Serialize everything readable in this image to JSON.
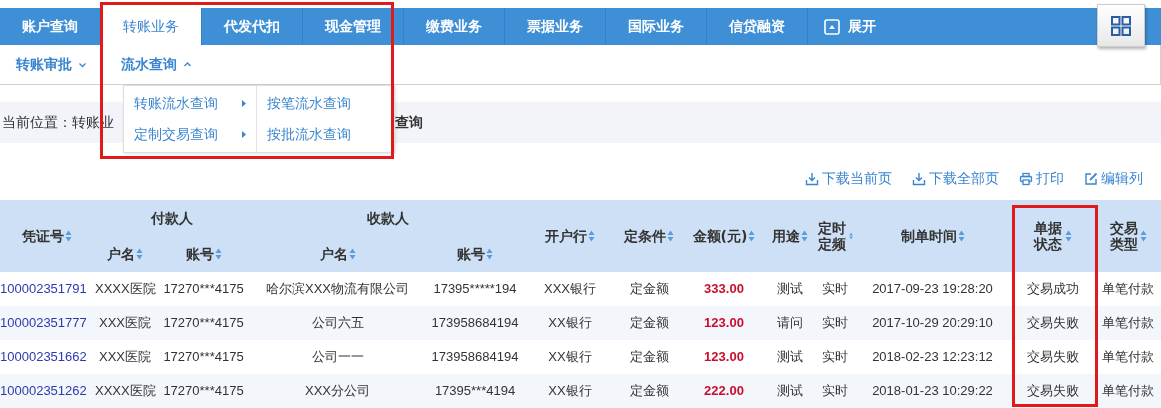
{
  "nav": {
    "tabs": [
      {
        "label": "账户查询",
        "selected": false
      },
      {
        "label": "转账业务",
        "selected": true
      },
      {
        "label": "代发代扣",
        "selected": false
      },
      {
        "label": "现金管理",
        "selected": false
      },
      {
        "label": "缴费业务",
        "selected": false
      },
      {
        "label": "票据业务",
        "selected": false
      },
      {
        "label": "国际业务",
        "selected": false
      },
      {
        "label": "信贷融资",
        "selected": false
      }
    ],
    "expand_button": {
      "label": "展开"
    }
  },
  "subnav": [
    {
      "label": "转账审批",
      "expanded": false
    },
    {
      "label": "流水查询",
      "expanded": true
    }
  ],
  "dropdown": {
    "items": [
      {
        "label": "转账流水查询",
        "has_submenu": true
      },
      {
        "label": "定制交易查询",
        "has_submenu": true
      }
    ],
    "submenu": [
      {
        "label": "按笔流水查询"
      },
      {
        "label": "按批流水查询"
      }
    ]
  },
  "breadcrumb": {
    "prefix": "当前位置：转账业",
    "tail": "查询"
  },
  "toolbar": [
    {
      "label": "下载当前页",
      "kind": "download"
    },
    {
      "label": "下载全部页",
      "kind": "download"
    },
    {
      "label": "打印",
      "kind": "print"
    },
    {
      "label": "编辑列",
      "kind": "edit"
    }
  ],
  "table": {
    "header_rows": [
      [
        {
          "label": "凭证号",
          "sortable": true,
          "kind": "link",
          "rowspan": 2
        },
        {
          "label": "付款人",
          "colspan": 2
        },
        {
          "label": "收款人",
          "colspan": 2
        },
        {
          "label": "开户行",
          "sortable": true,
          "rowspan": 2
        },
        {
          "label": "定条件",
          "sortable": true,
          "rowspan": 2
        },
        {
          "label": "金额(元)",
          "sortable": true,
          "kind": "amount",
          "rowspan": 2
        },
        {
          "label": "用途",
          "sortable": true,
          "rowspan": 2
        },
        {
          "label": "定时定频",
          "sortable": true,
          "rowspan": 2
        },
        {
          "label": "制单时间",
          "sortable": true,
          "rowspan": 2
        },
        {
          "label": "单据状态",
          "sortable": true,
          "rowspan": 2
        },
        {
          "label": "交易类型",
          "sortable": true,
          "rowspan": 2
        }
      ],
      [
        {
          "label": "户名",
          "sortable": true
        },
        {
          "label": "账号",
          "sortable": true
        },
        {
          "label": "户名",
          "sortable": true
        },
        {
          "label": "账号",
          "sortable": true
        }
      ]
    ],
    "rows": [
      [
        "100002351791",
        "XXXX医院",
        "17270***4175",
        "哈尔滨XXX物流有限公司",
        "17395*****194",
        "XXX银行",
        "定金额",
        "333.00",
        "测试",
        "实时",
        "2017-09-23 19:28:20",
        "交易成功",
        "单笔付款"
      ],
      [
        "100002351777",
        "XXX医院",
        "17270***4175",
        "公司六五",
        "173958684194",
        "XX银行",
        "定金额",
        "123.00",
        "请问",
        "实时",
        "2017-10-29 20:29:10",
        "交易失败",
        "单笔付款"
      ],
      [
        "100002351662",
        "XXX医院",
        "17270***4175",
        "公司一一",
        "173958684194",
        "XX银行",
        "定金额",
        "123.00",
        "测试",
        "实时",
        "2018-02-23 12:23:12",
        "交易失败",
        "单笔付款"
      ],
      [
        "100002351262",
        "XXXX医院",
        "17270***4175",
        "XXX分公司",
        "17395***4194",
        "XX银行",
        "定金额",
        "222.00",
        "测试",
        "实时",
        "2018-01-23 10:29:22",
        "交易失败",
        "单笔付款"
      ]
    ]
  }
}
